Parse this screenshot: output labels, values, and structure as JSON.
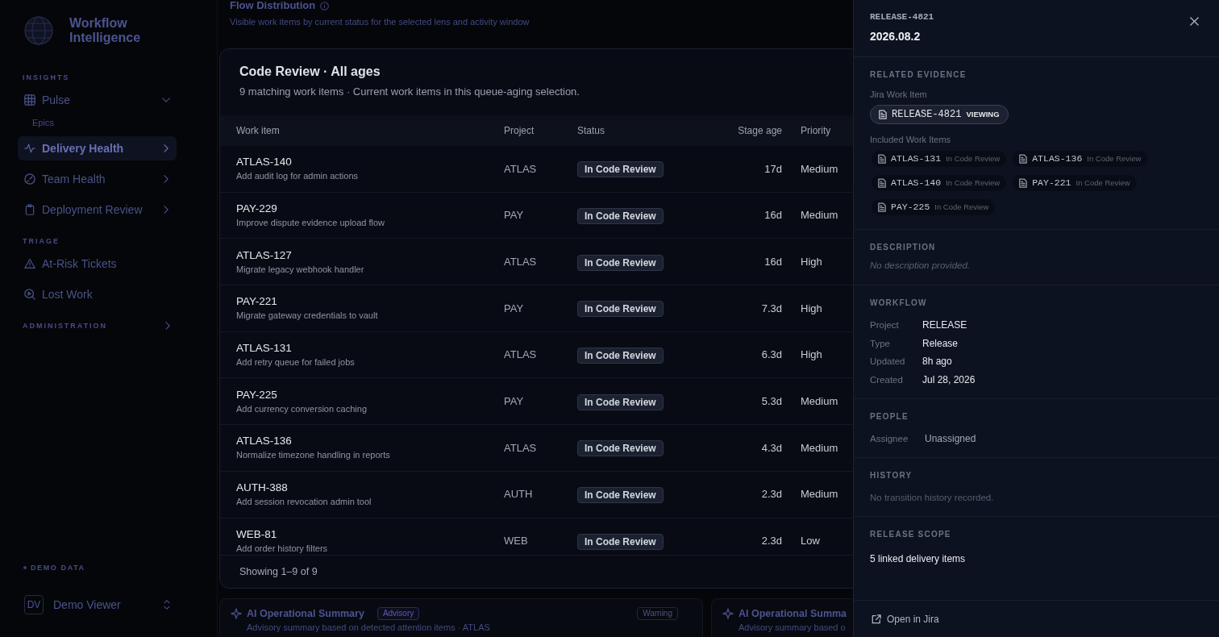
{
  "sidebar": {
    "brand": "Workflow Intelligence",
    "sections": [
      {
        "label": "INSIGHTS",
        "items": [
          {
            "label": "Pulse",
            "selected": false,
            "expanded": true,
            "children": [
              {
                "label": "Epics",
                "selected": false
              }
            ]
          },
          {
            "label": "Delivery Health",
            "selected": true,
            "expanded": false
          },
          {
            "label": "Team Health",
            "selected": false,
            "expanded": false
          },
          {
            "label": "Deployment Review",
            "selected": false,
            "expanded": false
          }
        ]
      },
      {
        "label": "TRIAGE",
        "items": [
          {
            "label": "At-Risk Tickets",
            "selected": false
          },
          {
            "label": "Lost Work",
            "selected": false
          }
        ]
      }
    ],
    "administration": {
      "label": "ADMINISTRATION",
      "expanded": false
    },
    "data_badge": "DEMO DATA",
    "user": {
      "initials": "DV",
      "name": "Demo Viewer"
    }
  },
  "main": {
    "flow_distribution": {
      "title": "Flow Distribution",
      "subtitle": "Visible work items by current status for the selected lens and activity window"
    },
    "summary_cards": [
      {
        "title": "AI Operational Summary",
        "badge": "Advisory",
        "severity": "Warning",
        "text": "Advisory summary based on detected attention items · ATLAS"
      },
      {
        "title": "AI Operational Summa",
        "text": "Advisory summary based o"
      }
    ]
  },
  "modal": {
    "title": "Code Review · All ages",
    "subtitle": "9 matching work items · Current work items in this queue-aging selection.",
    "columns": [
      "Work item",
      "Project",
      "Status",
      "Stage age",
      "Priority"
    ],
    "rows": [
      {
        "key": "ATLAS-140",
        "summary": "Add audit log for admin actions",
        "project": "ATLAS",
        "status": "In Code Review",
        "stage_age": "17d",
        "priority": "Medium"
      },
      {
        "key": "PAY-229",
        "summary": "Improve dispute evidence upload flow",
        "project": "PAY",
        "status": "In Code Review",
        "stage_age": "16d",
        "priority": "Medium"
      },
      {
        "key": "ATLAS-127",
        "summary": "Migrate legacy webhook handler",
        "project": "ATLAS",
        "status": "In Code Review",
        "stage_age": "16d",
        "priority": "High"
      },
      {
        "key": "PAY-221",
        "summary": "Migrate gateway credentials to vault",
        "project": "PAY",
        "status": "In Code Review",
        "stage_age": "7.3d",
        "priority": "High"
      },
      {
        "key": "ATLAS-131",
        "summary": "Add retry queue for failed jobs",
        "project": "ATLAS",
        "status": "In Code Review",
        "stage_age": "6.3d",
        "priority": "High"
      },
      {
        "key": "PAY-225",
        "summary": "Add currency conversion caching",
        "project": "PAY",
        "status": "In Code Review",
        "stage_age": "5.3d",
        "priority": "Medium"
      },
      {
        "key": "ATLAS-136",
        "summary": "Normalize timezone handling in reports",
        "project": "ATLAS",
        "status": "In Code Review",
        "stage_age": "4.3d",
        "priority": "Medium"
      },
      {
        "key": "AUTH-388",
        "summary": "Add session revocation admin tool",
        "project": "AUTH",
        "status": "In Code Review",
        "stage_age": "2.3d",
        "priority": "Medium"
      },
      {
        "key": "WEB-81",
        "summary": "Add order history filters",
        "project": "WEB",
        "status": "In Code Review",
        "stage_age": "2.3d",
        "priority": "Low"
      }
    ],
    "footer": "Showing 1–9 of 9"
  },
  "drawer": {
    "key": "RELEASE-4821",
    "title": "2026.08.2",
    "evidence": {
      "heading": "RELATED EVIDENCE",
      "jira_label": "Jira Work Item",
      "jira_item": {
        "key": "RELEASE-4821",
        "tag": "VIEWING"
      },
      "included_label": "Included Work Items",
      "included": [
        {
          "key": "ATLAS-131",
          "status": "In Code Review"
        },
        {
          "key": "ATLAS-136",
          "status": "In Code Review"
        },
        {
          "key": "ATLAS-140",
          "status": "In Code Review"
        },
        {
          "key": "PAY-221",
          "status": "In Code Review"
        },
        {
          "key": "PAY-225",
          "status": "In Code Review"
        }
      ]
    },
    "description": {
      "heading": "DESCRIPTION",
      "text": "No description provided."
    },
    "workflow": {
      "heading": "WORKFLOW",
      "fields": [
        {
          "label": "Project",
          "value": "RELEASE"
        },
        {
          "label": "Type",
          "value": "Release"
        },
        {
          "label": "Updated",
          "value": "8h ago"
        },
        {
          "label": "Created",
          "value": "Jul 28, 2026"
        }
      ]
    },
    "people": {
      "heading": "PEOPLE",
      "fields": [
        {
          "label": "Assignee",
          "value": "Unassigned"
        }
      ]
    },
    "history": {
      "heading": "HISTORY",
      "text": "No transition history recorded."
    },
    "release_scope": {
      "heading": "RELEASE SCOPE",
      "text": "5 linked delivery items"
    },
    "link": "Open in Jira"
  }
}
